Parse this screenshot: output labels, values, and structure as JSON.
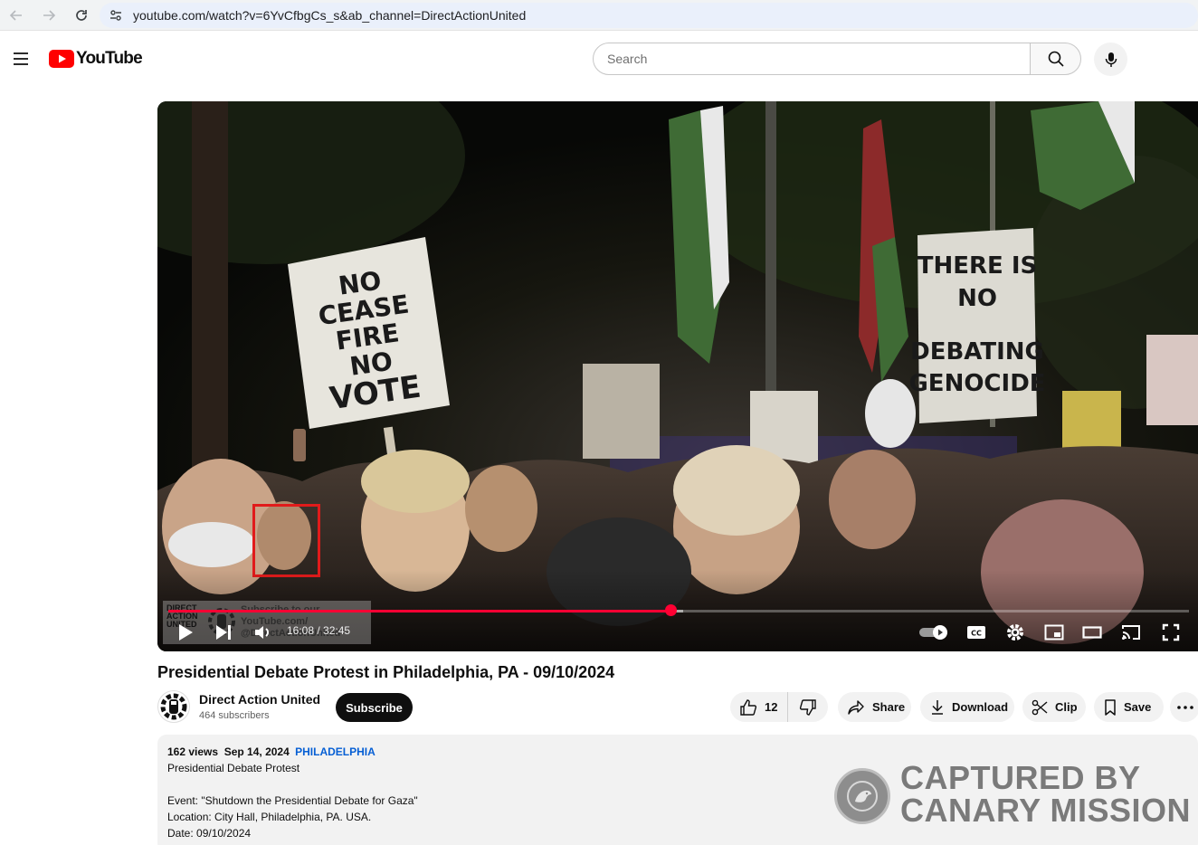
{
  "browser": {
    "url": "youtube.com/watch?v=6YvCfbgCs_s&ab_channel=DirectActionUnited"
  },
  "header": {
    "logo_text": "YouTube",
    "search_placeholder": "Search"
  },
  "player": {
    "time_display": "16:08 / 32:45",
    "progress_fraction": 0.4926,
    "watermark": {
      "logo_lines": [
        "DIRECT",
        "ACTION",
        "UNITED"
      ],
      "text_lines": [
        "Subscribe to our",
        "YouTube.com/",
        "@DirectActionUnited"
      ]
    },
    "signs": {
      "left_sign": [
        "NO",
        "CEASE",
        "FIRE",
        "NO",
        "VOTE"
      ],
      "right_sign": [
        "THERE IS",
        "NO",
        "DEBATING",
        "GENOCIDE"
      ]
    }
  },
  "video": {
    "title": "Presidential Debate Protest in Philadelphia, PA - 09/10/2024",
    "channel_name": "Direct Action United",
    "subscribers": "464 subscribers",
    "subscribe_label": "Subscribe",
    "like_count": "12",
    "share_label": "Share",
    "download_label": "Download",
    "clip_label": "Clip",
    "save_label": "Save"
  },
  "description": {
    "views": "162 views",
    "date": "Sep 14, 2024",
    "hashtag": "PHILADELPHIA",
    "lines": [
      "Presidential Debate Protest",
      "Event: \"Shutdown the Presidential Debate for Gaza\"",
      "Location: City Hall, Philadelphia, PA. USA.",
      "Date: 09/10/2024"
    ]
  },
  "overlay": {
    "canary_line1": "CAPTURED BY",
    "canary_line2": "CANARY MISSION"
  }
}
